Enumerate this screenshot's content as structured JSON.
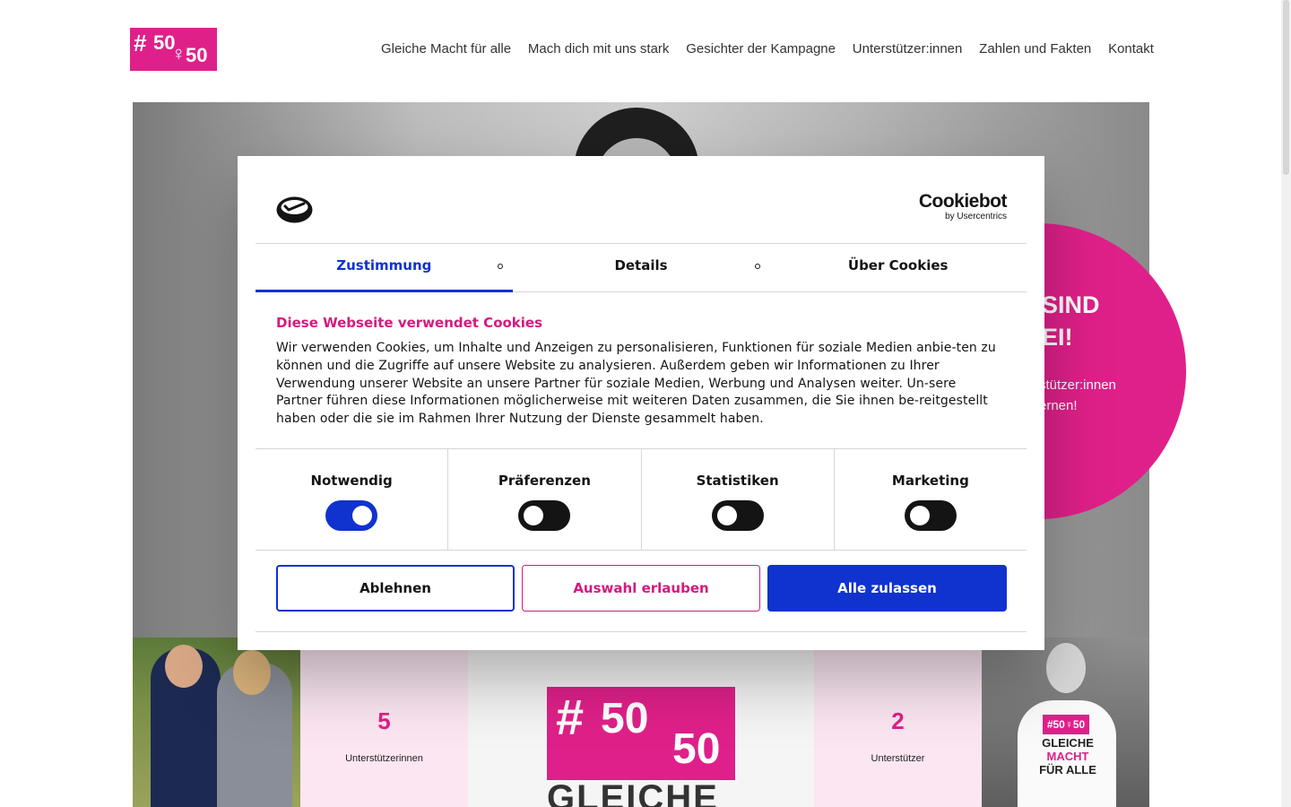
{
  "header": {
    "logo_text": "#50♀50♂",
    "nav": [
      {
        "label": "Gleiche Macht für alle"
      },
      {
        "label": "Mach dich mit uns stark"
      },
      {
        "label": "Gesichter der Kampagne"
      },
      {
        "label": "Unterstützer:innen"
      },
      {
        "label": "Zahlen und Fakten"
      },
      {
        "label": "Kontakt"
      }
    ]
  },
  "hero": {
    "title": "SIND\nEI!",
    "subtitle": "stützer:innen\nernen!"
  },
  "strip": {
    "count_a": {
      "number": "5",
      "label": "Unterstützerinnen"
    },
    "count_b": {
      "number": "2",
      "label": "Unterstützer"
    },
    "center_logo_text": "GLEICHE",
    "shirt_mini": "#50♀50",
    "shirt_text": [
      "GLEICHE",
      "MACHT",
      "FÜR ALLE"
    ]
  },
  "cookie_dialog": {
    "brand_name": "Cookiebot",
    "brand_sub": "by Usercentrics",
    "tabs": [
      {
        "label": "Zustimmung",
        "active": true
      },
      {
        "label": "Details",
        "active": false
      },
      {
        "label": "Über Cookies",
        "active": false
      }
    ],
    "title": "Diese Webseite verwendet Cookies",
    "text": "Wir verwenden Cookies, um Inhalte und Anzeigen zu personalisieren, Funktionen für soziale Medien anbie-ten zu können und die Zugriffe auf unsere Website zu analysieren. Außerdem geben wir Informationen zu Ihrer Verwendung unserer Website an unsere Partner für soziale Medien, Werbung und Analysen weiter. Un-sere Partner führen diese Informationen möglicherweise mit weiteren Daten zusammen, die Sie ihnen be-reitgestellt haben oder die sie im Rahmen Ihrer Nutzung der Dienste gesammelt haben.",
    "toggles": [
      {
        "label": "Notwendig",
        "on": true
      },
      {
        "label": "Präferenzen",
        "on": false
      },
      {
        "label": "Statistiken",
        "on": false
      },
      {
        "label": "Marketing",
        "on": false
      }
    ],
    "buttons": {
      "deny": "Ablehnen",
      "select": "Auswahl erlauben",
      "allow_all": "Alle zulassen"
    }
  },
  "colors": {
    "brand_pink": "#e0208a",
    "cookiebot_blue": "#1032cf",
    "title_pink": "#d6197f",
    "tile_pink": "#fbe6f1"
  }
}
